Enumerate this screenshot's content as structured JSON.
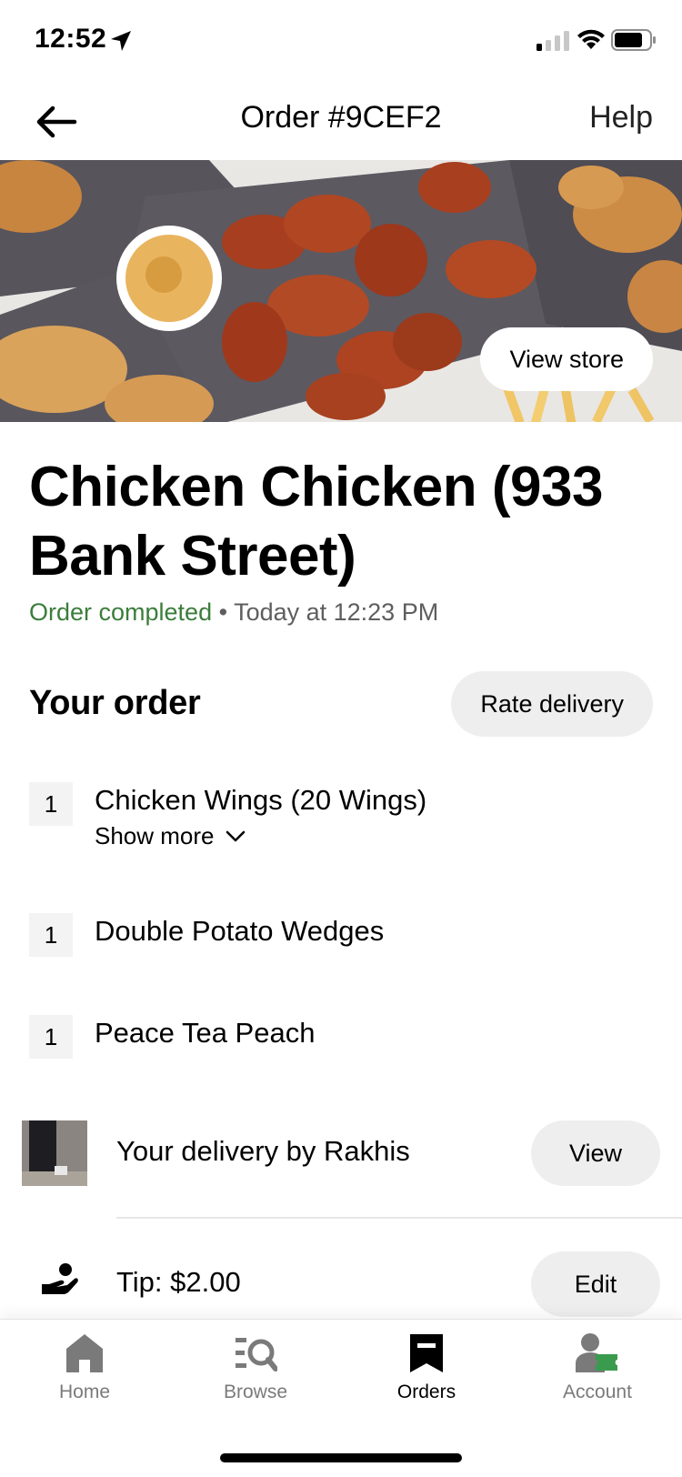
{
  "status_bar": {
    "time": "12:52"
  },
  "header": {
    "title": "Order #9CEF2",
    "help_label": "Help"
  },
  "hero": {
    "view_store_label": "View store"
  },
  "store": {
    "name": "Chicken Chicken (933 Bank Street)",
    "status": "Order completed",
    "separator": " • ",
    "time": "Today at 12:23 PM"
  },
  "order": {
    "title": "Your order",
    "rate_label": "Rate delivery",
    "items": [
      {
        "qty": "1",
        "name": "Chicken Wings (20 Wings)",
        "show_more": "Show more"
      },
      {
        "qty": "1",
        "name": "Double Potato Wedges"
      },
      {
        "qty": "1",
        "name": "Peace Tea Peach"
      }
    ]
  },
  "delivery": {
    "text": "Your delivery by Rakhis",
    "view_label": "View"
  },
  "tip": {
    "text": "Tip: $2.00",
    "edit_label": "Edit"
  },
  "tabs": [
    {
      "label": "Home",
      "icon": "home-icon"
    },
    {
      "label": "Browse",
      "icon": "browse-icon"
    },
    {
      "label": "Orders",
      "icon": "orders-icon",
      "active": true
    },
    {
      "label": "Account",
      "icon": "account-icon"
    }
  ],
  "colors": {
    "status_green": "#3b7d3b",
    "accent_green": "#3a9b4e"
  }
}
